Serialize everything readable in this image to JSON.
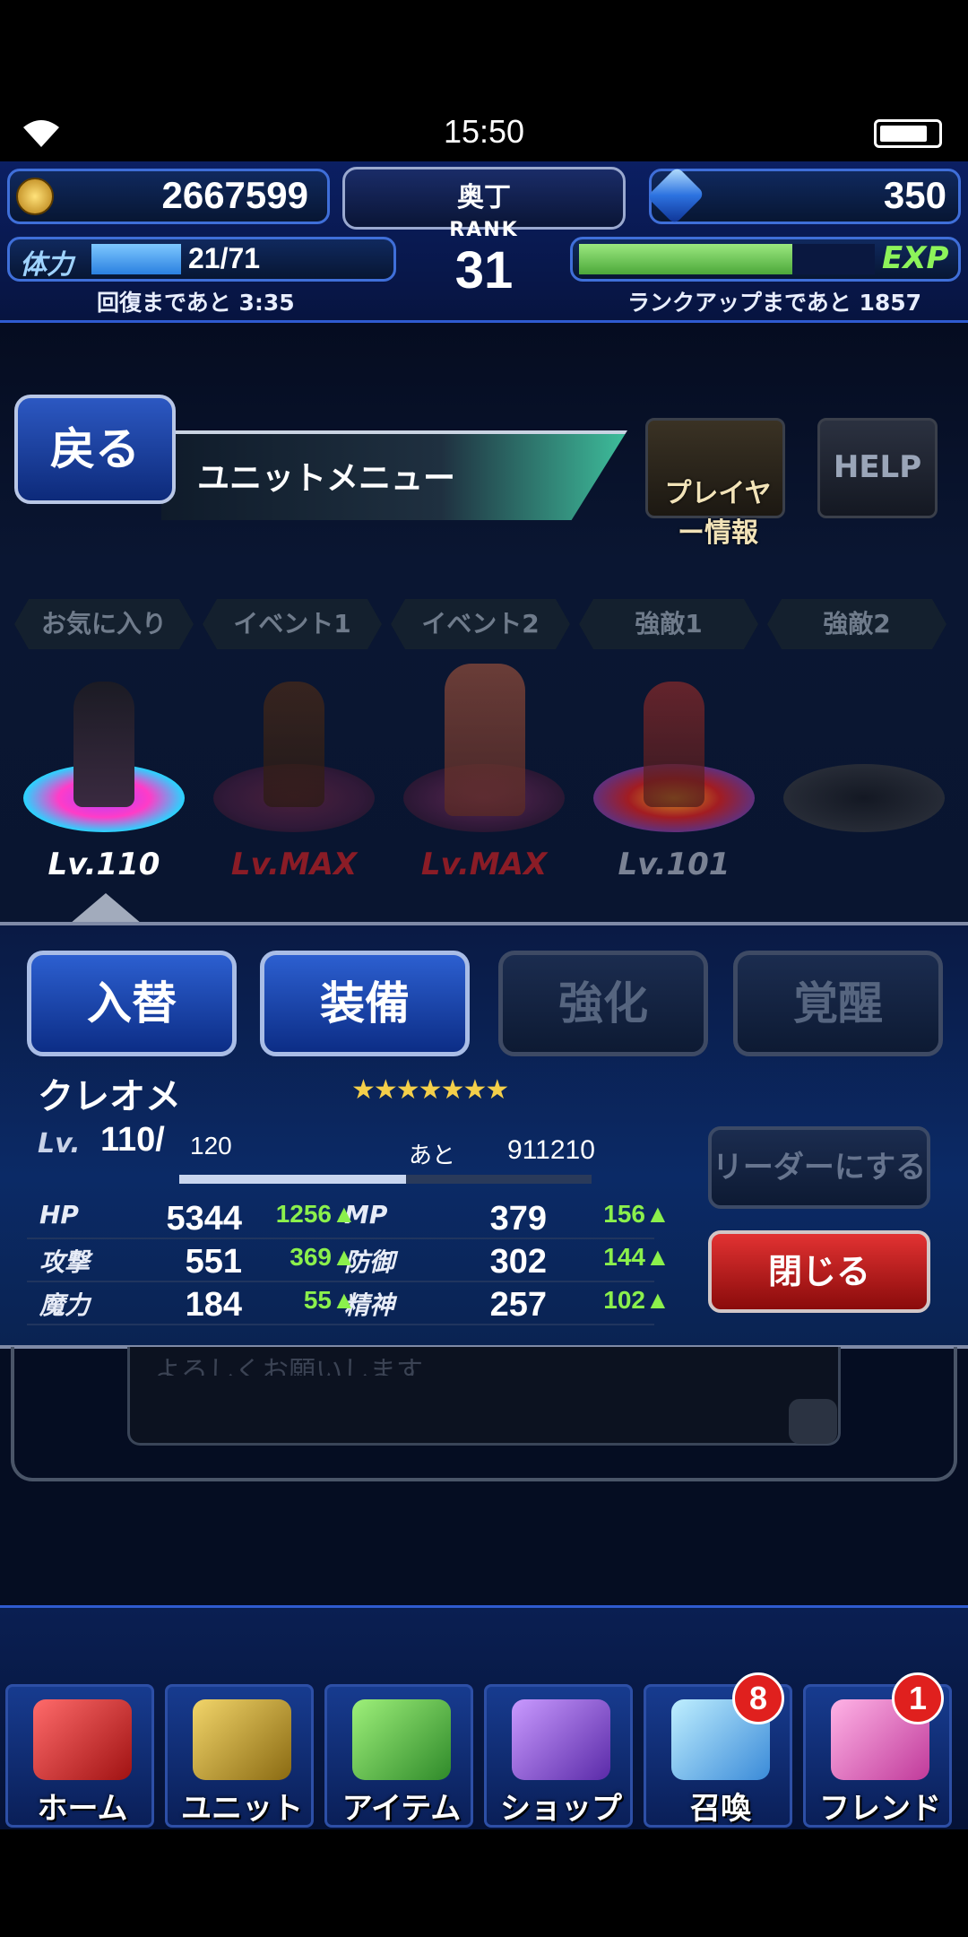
{
  "status": {
    "time": "15:50"
  },
  "header": {
    "gil": "2667599",
    "player_name": "奥丁",
    "gems": "350",
    "rank_label": "RANK",
    "rank": "31",
    "stamina_label": "体力",
    "stamina": "21/71",
    "stamina_ratio": 0.296,
    "recover_text": "回復まであと 3:35",
    "exp_label": "EXP",
    "exp_ratio": 0.72,
    "rankup_text": "ランクアップまであと 1857"
  },
  "nav_top": {
    "back": "戻る",
    "title": "ユニットメニュー",
    "player_info": "プレイヤー情報",
    "help": "HELP"
  },
  "tabs": [
    "お気に入り",
    "イベント1",
    "イベント2",
    "強敵1",
    "強敵2"
  ],
  "party": [
    {
      "level": "Lv.110"
    },
    {
      "level": "Lv.MAX"
    },
    {
      "level": "Lv.MAX"
    },
    {
      "level": "Lv.101"
    },
    {
      "level": ""
    }
  ],
  "actions": {
    "swap": "入替",
    "equip": "装備",
    "enhance": "強化",
    "awaken": "覚醒"
  },
  "unit": {
    "name": "クレオメ",
    "stars": "★★★★★★★",
    "lv_label": "Lv.",
    "lv": "110/",
    "lv_max": "120",
    "next_label": "あと",
    "next_exp": "911210",
    "exp_ratio": 0.55,
    "stats": [
      {
        "l1": "HP",
        "v1": "5344",
        "b1": "1256",
        "l2": "MP",
        "v2": "379",
        "b2": "156"
      },
      {
        "l1": "攻撃",
        "v1": "551",
        "b1": "369",
        "l2": "防御",
        "v2": "302",
        "b2": "144"
      },
      {
        "l1": "魔力",
        "v1": "184",
        "b1": "55",
        "l2": "精神",
        "v2": "257",
        "b2": "102"
      }
    ]
  },
  "side": {
    "leader": "リーダーにする",
    "close": "閉じる"
  },
  "message": "よろしくお願いします",
  "bottom_nav": [
    {
      "label": "ホーム",
      "icon": "sword-icon",
      "badge": ""
    },
    {
      "label": "ユニット",
      "icon": "knight-icon",
      "badge": ""
    },
    {
      "label": "アイテム",
      "icon": "potion-icon",
      "badge": ""
    },
    {
      "label": "ショップ",
      "icon": "shop-icon",
      "badge": ""
    },
    {
      "label": "召喚",
      "icon": "crystal-icon",
      "badge": "8"
    },
    {
      "label": "フレンド",
      "icon": "friends-icon",
      "badge": "1"
    }
  ],
  "colors": {
    "accent": "#2f5bd0",
    "bonus_green": "#8bf04c",
    "close_red": "#c91c1c"
  }
}
